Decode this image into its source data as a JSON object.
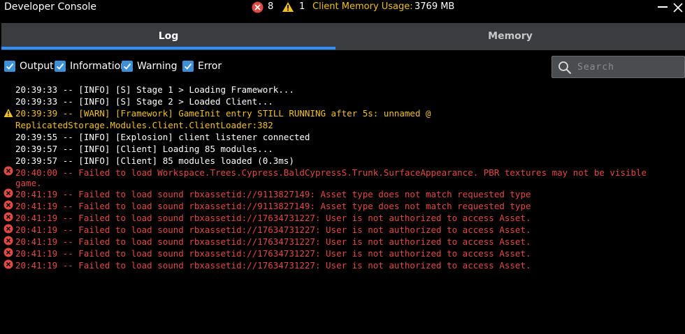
{
  "window": {
    "title": "Developer Console",
    "error_count": "8",
    "warning_count": "1",
    "memory_label": "Client Memory Usage:",
    "memory_value": "3769 MB",
    "accent_color": "#2e90ff"
  },
  "tabs": [
    {
      "label": "Log",
      "active": true
    },
    {
      "label": "Memory",
      "active": false
    }
  ],
  "filters": [
    {
      "label": "Output",
      "checked": true
    },
    {
      "label": "Information",
      "checked": true
    },
    {
      "label": "Warning",
      "checked": true
    },
    {
      "label": "Error",
      "checked": true
    }
  ],
  "search": {
    "placeholder": "Search",
    "value": ""
  },
  "log": [
    {
      "level": "info",
      "text": "20:39:33 -- [INFO] [S] Stage 1 > Loading Framework..."
    },
    {
      "level": "info",
      "text": "20:39:33 -- [INFO] [S] Stage 2 > Loaded Client..."
    },
    {
      "level": "warn",
      "text": "20:39:39 -- [WARN] [Framework] GameInit entry STILL RUNNING after 5s: unnamed @",
      "continuation": "ReplicatedStorage.Modules.Client.ClientLoader:382"
    },
    {
      "level": "info",
      "text": "20:39:55 -- [INFO] [Explosion] client listener connected"
    },
    {
      "level": "info",
      "text": "20:39:57 -- [INFO] [Client] Loading 85 modules..."
    },
    {
      "level": "info",
      "text": "20:39:57 -- [INFO] [Client] 85 modules loaded (0.3ms)"
    },
    {
      "level": "error",
      "text": "20:40:00 -- Failed to load Workspace.Trees.Cypress.BaldCypressS.Trunk.SurfaceAppearance. PBR textures may not be visible",
      "continuation": "game."
    },
    {
      "level": "error",
      "text": "20:41:19 -- Failed to load sound rbxassetid://9113827149: Asset type does not match requested type"
    },
    {
      "level": "error",
      "text": "20:41:19 -- Failed to load sound rbxassetid://9113827149: Asset type does not match requested type"
    },
    {
      "level": "error",
      "text": "20:41:19 -- Failed to load sound rbxassetid://17634731227: User is not authorized to access Asset."
    },
    {
      "level": "error",
      "text": "20:41:19 -- Failed to load sound rbxassetid://17634731227: User is not authorized to access Asset."
    },
    {
      "level": "error",
      "text": "20:41:19 -- Failed to load sound rbxassetid://17634731227: User is not authorized to access Asset."
    },
    {
      "level": "error",
      "text": "20:41:19 -- Failed to load sound rbxassetid://17634731227: User is not authorized to access Asset."
    },
    {
      "level": "error",
      "text": "20:41:19 -- Failed to load sound rbxassetid://17634731227: User is not authorized to access Asset."
    }
  ],
  "icons": {
    "error": "error-circle-icon",
    "warning": "warning-triangle-icon",
    "search": "search-icon",
    "close": "close-icon",
    "minimize": "minimize-icon",
    "checkbox": "checkmark-icon"
  },
  "colors": {
    "info": "#ffffff",
    "warning": "#f0c020",
    "error": "#e04a44",
    "memory_label": "#f0c010"
  }
}
